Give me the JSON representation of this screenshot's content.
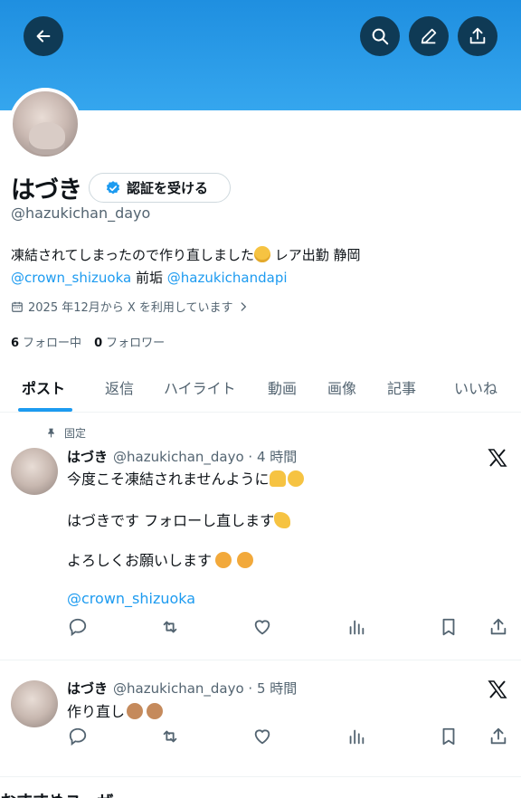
{
  "profile": {
    "name": "はづき",
    "verify_label": "認証を受ける",
    "handle": "@hazukichan_dayo",
    "bio_line1": "凍結されてしまったので作り直しました",
    "bio_line1_tail": " レア出勤 静岡",
    "bio_mention1": "@crown_shizuoka",
    "bio_mid": " 前垢 ",
    "bio_mention2": "@hazukichandapi",
    "joined": "2025 年12月から X を利用しています",
    "following_count": "6",
    "following_label": "フォロー中",
    "followers_count": "0",
    "followers_label": "フォロワー"
  },
  "tabs": [
    "ポスト",
    "返信",
    "ハイライト",
    "動画",
    "画像",
    "記事",
    "いいね"
  ],
  "pinned_label": "固定",
  "posts": [
    {
      "name": "はづき",
      "meta": "@hazukichan_dayo · 4 時間",
      "line1": "今度こそ凍結されませんように",
      "line2": "はづきです フォローし直します",
      "line3": "よろしくお願いします",
      "mention": "@crown_shizuoka"
    },
    {
      "name": "はづき",
      "meta": "@hazukichan_dayo · 5 時間",
      "line1": "作り直し"
    }
  ],
  "next_section": "おすすめユーザー",
  "icons": [
    "back-arrow-icon",
    "search-icon",
    "edit-icon",
    "share-icon",
    "verified-badge-icon",
    "calendar-icon",
    "chevron-right-icon",
    "pin-icon",
    "x-logo-icon",
    "reply-icon",
    "repost-icon",
    "like-icon",
    "views-icon",
    "bookmark-icon",
    "share-icon"
  ],
  "colors": {
    "accent": "#1d9bf0",
    "banner": "#2a9be8",
    "secondary_text": "#536471"
  }
}
